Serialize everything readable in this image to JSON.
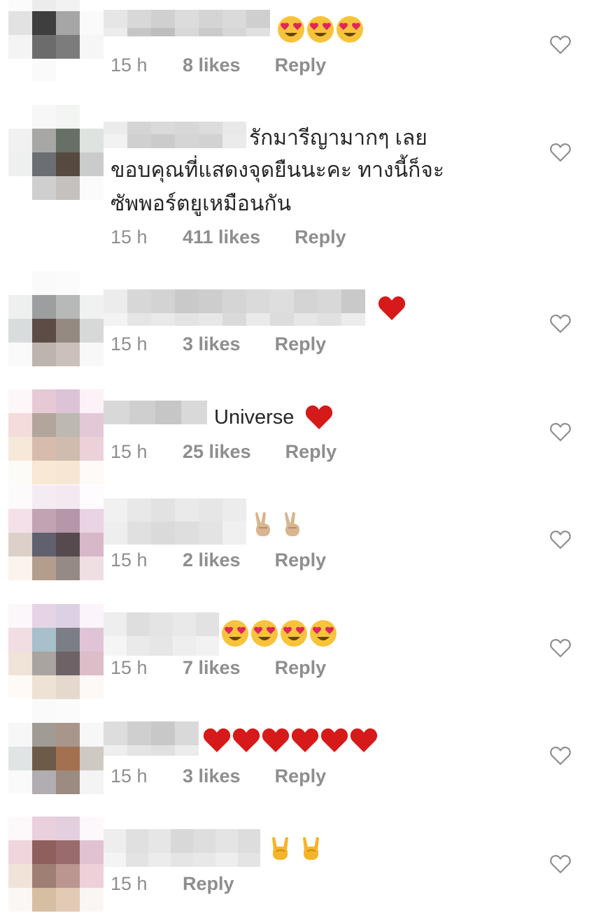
{
  "comments": [
    {
      "text": "",
      "emoji": "heart-eyes-emoji",
      "emoji_count": 3,
      "time": "15 h",
      "likes": "8 likes",
      "reply": "Reply"
    },
    {
      "text_lines": [
        "รักมารีญามากๆ เลย",
        "ขอบคุณที่แสดงจุดยืนนะคะ ทางนี้ก็จะ",
        "ซัพพอร์ตยูเหมือนกัน"
      ],
      "time": "15 h",
      "likes": "411 likes",
      "reply": "Reply"
    },
    {
      "text": "",
      "emoji": "red-heart-emoji",
      "emoji_count": 1,
      "time": "15 h",
      "likes": "3 likes",
      "reply": "Reply"
    },
    {
      "text": "Universe",
      "emoji": "red-heart-emoji",
      "emoji_count": 1,
      "time": "15 h",
      "likes": "25 likes",
      "reply": "Reply"
    },
    {
      "text": "",
      "emoji": "victory-hand-emoji",
      "emoji_count": 2,
      "time": "15 h",
      "likes": "2 likes",
      "reply": "Reply"
    },
    {
      "text": "",
      "emoji": "heart-eyes-emoji",
      "emoji_count": 4,
      "time": "15 h",
      "likes": "7 likes",
      "reply": "Reply"
    },
    {
      "text": "",
      "emoji": "red-heart-emoji",
      "emoji_count": 6,
      "time": "15 h",
      "likes": "3 likes",
      "reply": "Reply"
    },
    {
      "text": "",
      "emoji": "rock-on-hand-emoji",
      "emoji_count": 2,
      "time": "15 h",
      "likes": "",
      "reply": "Reply"
    }
  ],
  "icons": {
    "like": "heart-outline-icon"
  },
  "colors": {
    "text": "#262626",
    "meta": "#8e8e8e",
    "heart": "#d61a1a",
    "emoji_face": "#f7c33a",
    "like_icon": "#8e8e8e"
  }
}
